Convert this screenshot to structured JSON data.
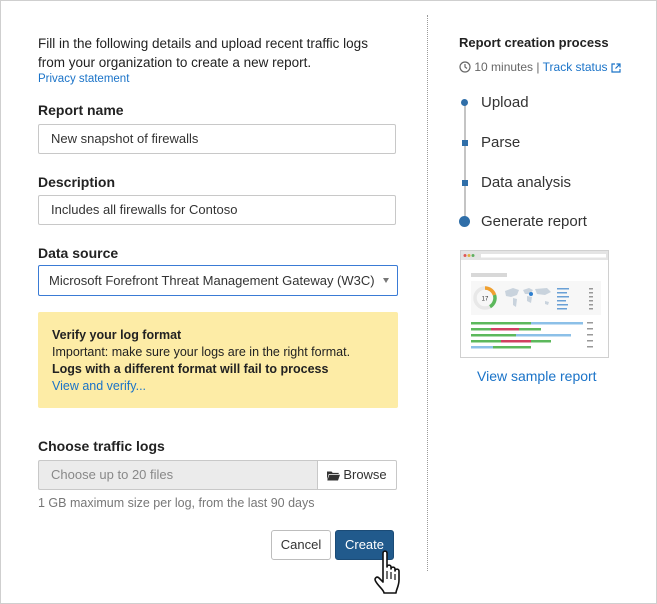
{
  "form": {
    "intro": "Fill in the following details and upload recent traffic logs from your organization to create a new report.",
    "privacy_link": "Privacy statement",
    "report_name": {
      "label": "Report name",
      "value": "New snapshot of firewalls"
    },
    "description": {
      "label": "Description",
      "value": "Includes all firewalls for Contoso"
    },
    "data_source": {
      "label": "Data source",
      "value": "Microsoft Forefront Threat Management Gateway (W3C)"
    },
    "warning": {
      "title": "Verify your log format",
      "line1": "Important: make sure your logs are in the right format.",
      "line2": "Logs with a different format will fail to process",
      "link": "View and verify..."
    },
    "traffic_logs": {
      "label": "Choose traffic logs",
      "placeholder": "Choose up to 20 files",
      "browse_label": "Browse",
      "hint": "1 GB maximum size per log, from the last 90 days"
    },
    "cancel_label": "Cancel",
    "create_label": "Create"
  },
  "process": {
    "title": "Report creation process",
    "duration": "10 minutes",
    "separator": "|",
    "track_status": "Track status",
    "steps": [
      {
        "label": "Upload"
      },
      {
        "label": "Parse"
      },
      {
        "label": "Data analysis"
      },
      {
        "label": "Generate report"
      }
    ],
    "sample_report_link": "View sample report",
    "thumbnail_count": "17"
  },
  "colors": {
    "accent": "#215a8c",
    "link": "#1a73c8",
    "warning_bg": "#fdeca6",
    "step_dot": "#2f6ea8"
  }
}
